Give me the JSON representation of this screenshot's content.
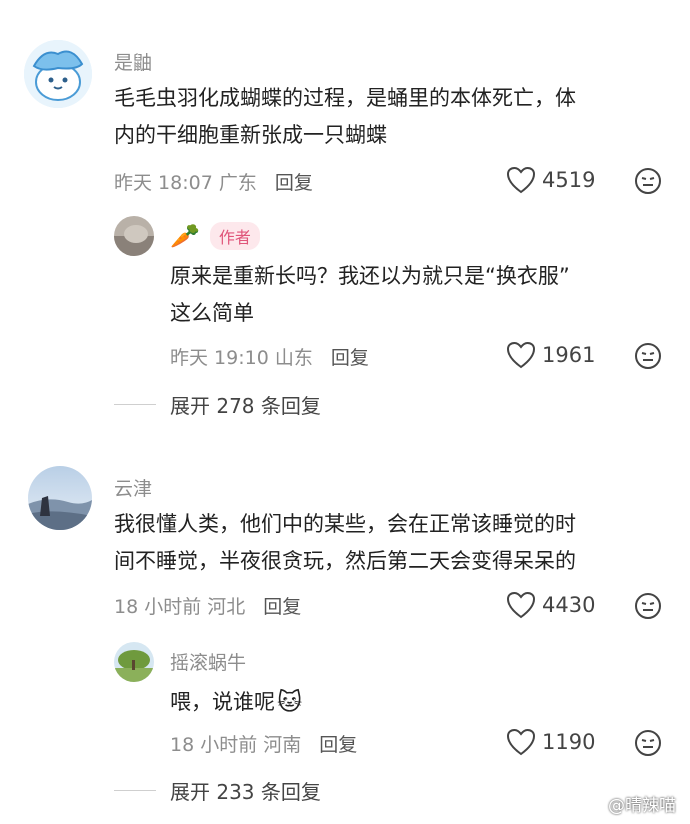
{
  "comments": [
    {
      "user": "是鼬",
      "text": "毛毛虫羽化成蝴蝶的过程，是蛹里的本体死亡，体\n内的干细胞重新张成一只蝴蝶",
      "time": "昨天 18:07 广东",
      "reply_label": "回复",
      "likes": "4519",
      "reply": {
        "user_emoji": "🥕",
        "badge": "作者",
        "text": "原来是重新长吗？我还以为就只是“换衣服”\n这么简单",
        "time": "昨天 19:10 山东",
        "reply_label": "回复",
        "likes": "1961"
      },
      "expand": "展开 278 条回复"
    },
    {
      "user": "云津",
      "text": "我很懂人类，他们中的某些，会在正常该睡觉的时\n间不睡觉，半夜很贪玩，然后第二天会变得呆呆的",
      "time": "18 小时前 河北",
      "reply_label": "回复",
      "likes": "4430",
      "reply": {
        "user": "摇滚蜗牛",
        "text": "喂，说谁呢",
        "emoji": "🐱",
        "time": "18 小时前 河南",
        "reply_label": "回复",
        "likes": "1190"
      },
      "expand": "展开 233 条回复"
    }
  ],
  "watermark": "@晴辣喵"
}
